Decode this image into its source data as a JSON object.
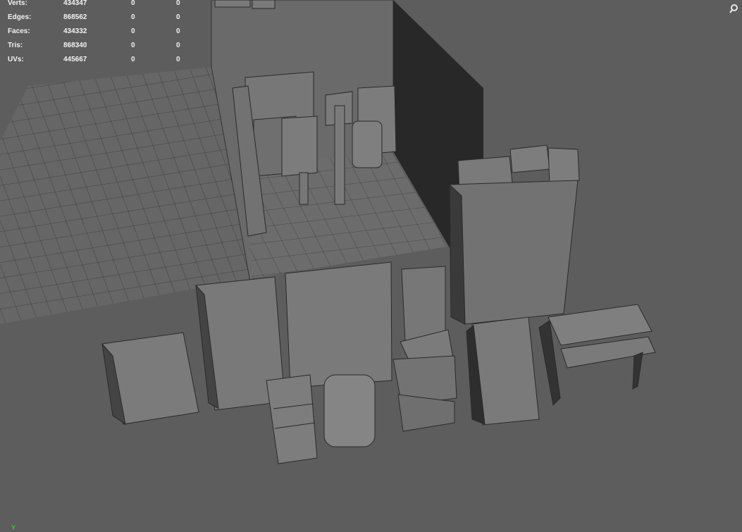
{
  "stats": {
    "rows": [
      {
        "label": "Verts:",
        "values": [
          "434347",
          "0",
          "0"
        ]
      },
      {
        "label": "Edges:",
        "values": [
          "868562",
          "0",
          "0"
        ]
      },
      {
        "label": "Faces:",
        "values": [
          "434332",
          "0",
          "0"
        ]
      },
      {
        "label": "Tris:",
        "values": [
          "868340",
          "0",
          "0"
        ]
      },
      {
        "label": "UVs:",
        "values": [
          "445667",
          "0",
          "0"
        ]
      }
    ]
  },
  "axis_indicator": {
    "label": "Y",
    "color": "#2fd12f"
  },
  "icons": {
    "corner": "search-icon"
  },
  "colors": {
    "background": "#5d5d5d",
    "hud_text": "#f2f2f2",
    "grid": "#3a3a3a"
  }
}
